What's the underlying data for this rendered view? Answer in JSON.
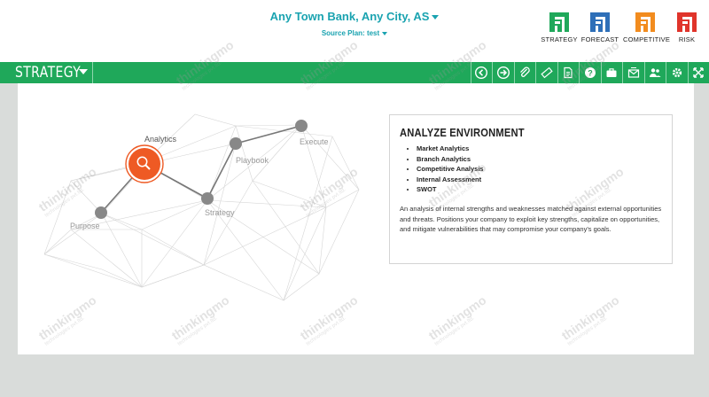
{
  "header": {
    "bank_title": "Any Town Bank, Any City, AS",
    "source_plan": "Source Plan: test"
  },
  "modules": [
    {
      "label": "STRATEGY",
      "color": "#1fa85a",
      "icon": "strategy-icon"
    },
    {
      "label": "FORECAST",
      "color": "#2e6fb8",
      "icon": "forecast-icon"
    },
    {
      "label": "COMPETITIVE",
      "color": "#f28c1f",
      "icon": "competitive-icon"
    },
    {
      "label": "RISK",
      "color": "#e0342b",
      "icon": "risk-icon"
    }
  ],
  "navbar": {
    "title": "STRATEGY",
    "color": "#1fa85a",
    "tools": [
      "back-arrow-icon",
      "forward-arrow-icon",
      "paperclip-icon",
      "ruler-icon",
      "document-icon",
      "question-icon",
      "briefcase-icon",
      "mail-icon",
      "users-icon",
      "gear-icon",
      "expand-icon"
    ]
  },
  "network": {
    "nodes": {
      "analytics": "Analytics",
      "playbook": "Playbook",
      "execute": "Execute",
      "strategy": "Strategy",
      "purpose": "Purpose"
    },
    "active_color": "#ee5a24"
  },
  "card": {
    "title": "ANALYZE ENVIRONMENT",
    "items": [
      "Market Analytics",
      "Branch Analytics",
      "Competitive Analysis",
      "Internal Assessment",
      "SWOT"
    ],
    "description": "An analysis of internal strengths and weaknesses matched against external opportunities and threats. Positions your company to exploit key strengths, capitalize on opportunities, and mitigate vulnerabilities that may compromise your company's goals."
  },
  "watermark": {
    "main": "thinkingmo",
    "sub": "technologies pvt.ltd."
  }
}
